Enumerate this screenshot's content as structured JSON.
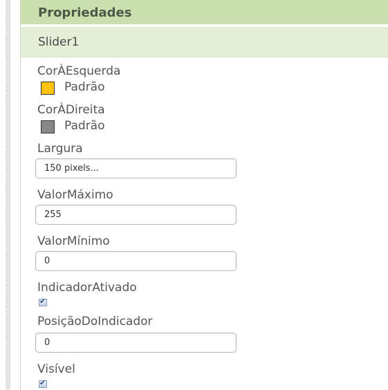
{
  "panel_title": "Propriedades",
  "component_name": "Slider1",
  "colors": {
    "left_swatch": "#FFC20E",
    "right_swatch": "#888888",
    "header_bg": "#C9DFAE",
    "component_bg": "#E5EFD8"
  },
  "properties": {
    "color_left": {
      "label": "CorÀEsquerda",
      "value": "Padrão"
    },
    "color_right": {
      "label": "CorÀDireita",
      "value": "Padrão"
    },
    "width": {
      "label": "Largura",
      "value": "150 pixels..."
    },
    "max_value": {
      "label": "ValorMáximo",
      "value": "255"
    },
    "min_value": {
      "label": "ValorMínimo",
      "value": "0"
    },
    "thumb_enabled": {
      "label": "IndicadorAtivado",
      "checked": true
    },
    "thumb_position": {
      "label": "PosiçãoDoIndicador",
      "value": "0"
    },
    "visible": {
      "label": "Visível",
      "checked": true
    }
  }
}
